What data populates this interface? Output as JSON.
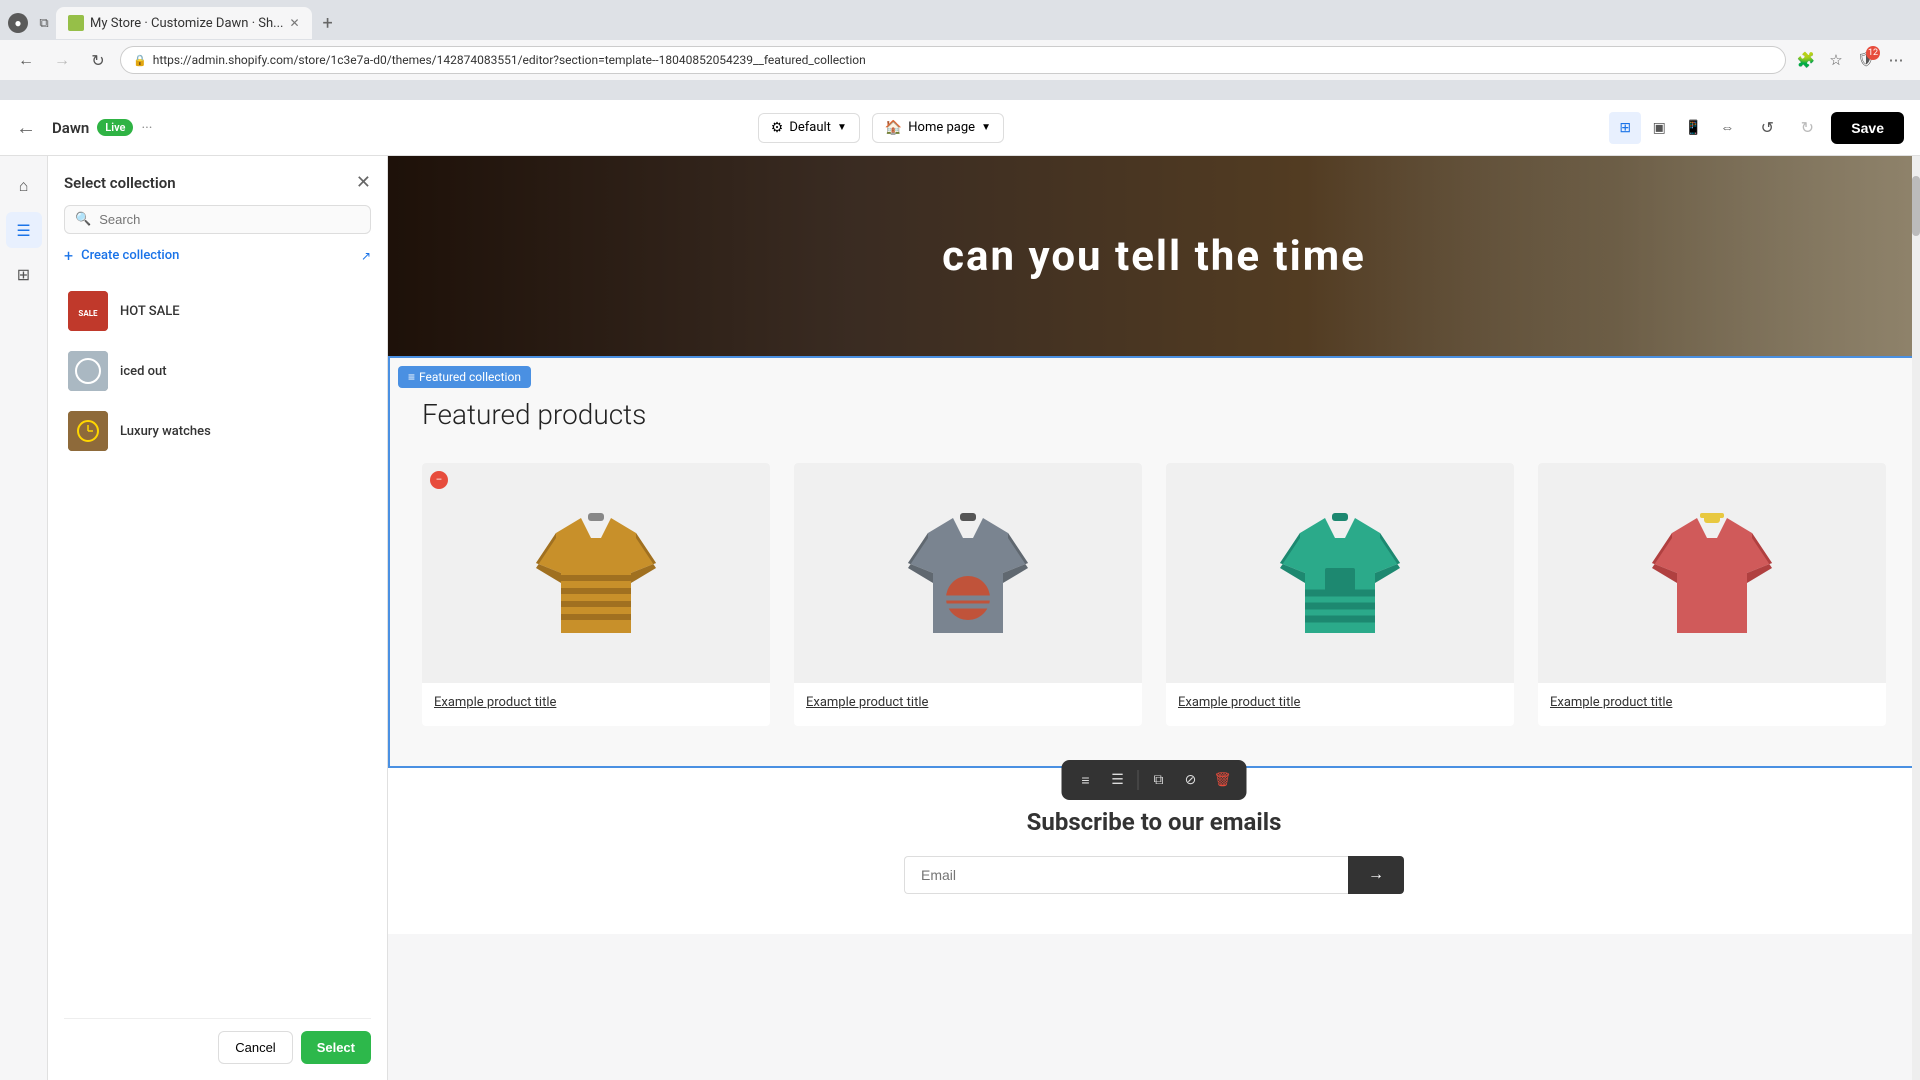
{
  "browser": {
    "tab_title": "My Store · Customize Dawn · Sh...",
    "address": "https://admin.shopify.com/store/1c3e7a-d0/themes/142874083551/editor?section=template--18040852054239__featured_collection",
    "new_tab": "+"
  },
  "shopify_header": {
    "back_label": "←",
    "store_name": "Dawn",
    "live_label": "Live",
    "more_label": "···",
    "default_label": "Default",
    "homepage_label": "Home page",
    "save_label": "Save"
  },
  "panel": {
    "title": "Select collection",
    "search_placeholder": "Search",
    "create_label": "Create collection",
    "collections": [
      {
        "name": "HOT SALE",
        "id": "hot-sale"
      },
      {
        "name": "iced out",
        "id": "iced-out"
      },
      {
        "name": "Luxury watches",
        "id": "luxury-watches"
      }
    ],
    "cancel_label": "Cancel",
    "select_label": "Select"
  },
  "canvas": {
    "hero_text": "can you tell the time",
    "featured_tag": "≡ Featured collection",
    "featured_title": "Featured products",
    "products": [
      {
        "title": "Example product title"
      },
      {
        "title": "Example product title"
      },
      {
        "title": "Example product title"
      },
      {
        "title": "Example product title"
      }
    ],
    "subscribe_title": "Subscribe to our emails",
    "email_placeholder": "Email"
  },
  "toolbar": {
    "icons": [
      "align-left",
      "align-center",
      "copy",
      "link",
      "delete"
    ]
  }
}
